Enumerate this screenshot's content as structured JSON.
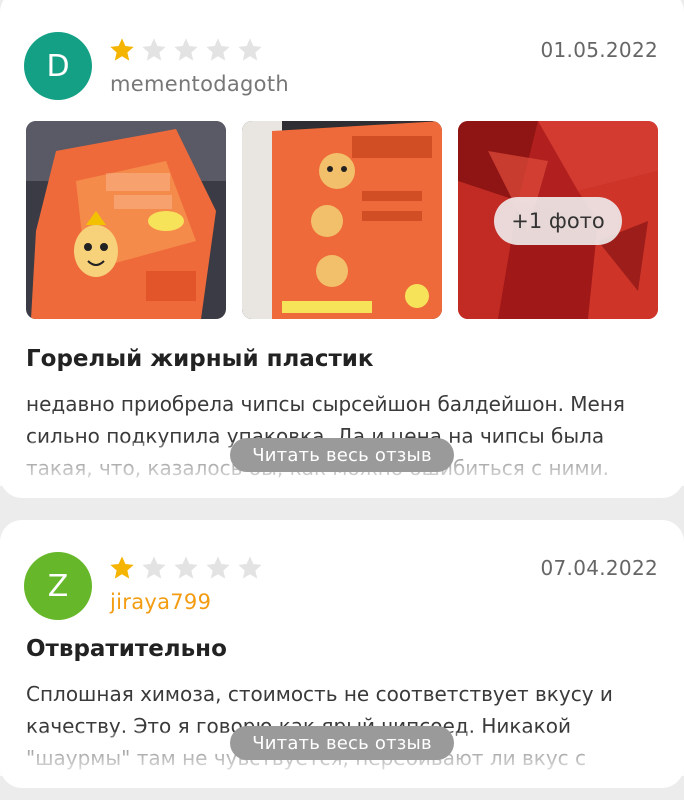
{
  "colors": {
    "star_filled": "#f4b400",
    "star_empty": "#e3e3e3",
    "avatar_d": "#14a085",
    "avatar_z": "#66b82a",
    "username_orange": "#f39c12",
    "username_gray": "#777777"
  },
  "reviews": [
    {
      "avatar_letter": "D",
      "rating": 1,
      "rating_max": 5,
      "username": "mementodagoth",
      "date": "01.05.2022",
      "more_photos_label": "+1 фото",
      "title": "Горелый жирный пластик",
      "text": "недавно приобрела чипсы сырсейшон балдейшон. Меня сильно подкупила упаковка. Да и цена на чипсы была такая, что, казалось бы, как можно ошибиться с ними. \"Это же не",
      "read_more": "Читать весь отзыв"
    },
    {
      "avatar_letter": "Z",
      "rating": 1,
      "rating_max": 5,
      "username": "jiraya799",
      "date": "07.04.2022",
      "title": "Отвратительно",
      "text": "Сплошная химоза, стоимость не соответствует вкусу и качеству. Это я говорю как ярый чипсоед. Никакой \"шаурмы\" там не чувствуется, перебивают ли вкус с других",
      "read_more": "Читать весь отзыв"
    }
  ]
}
